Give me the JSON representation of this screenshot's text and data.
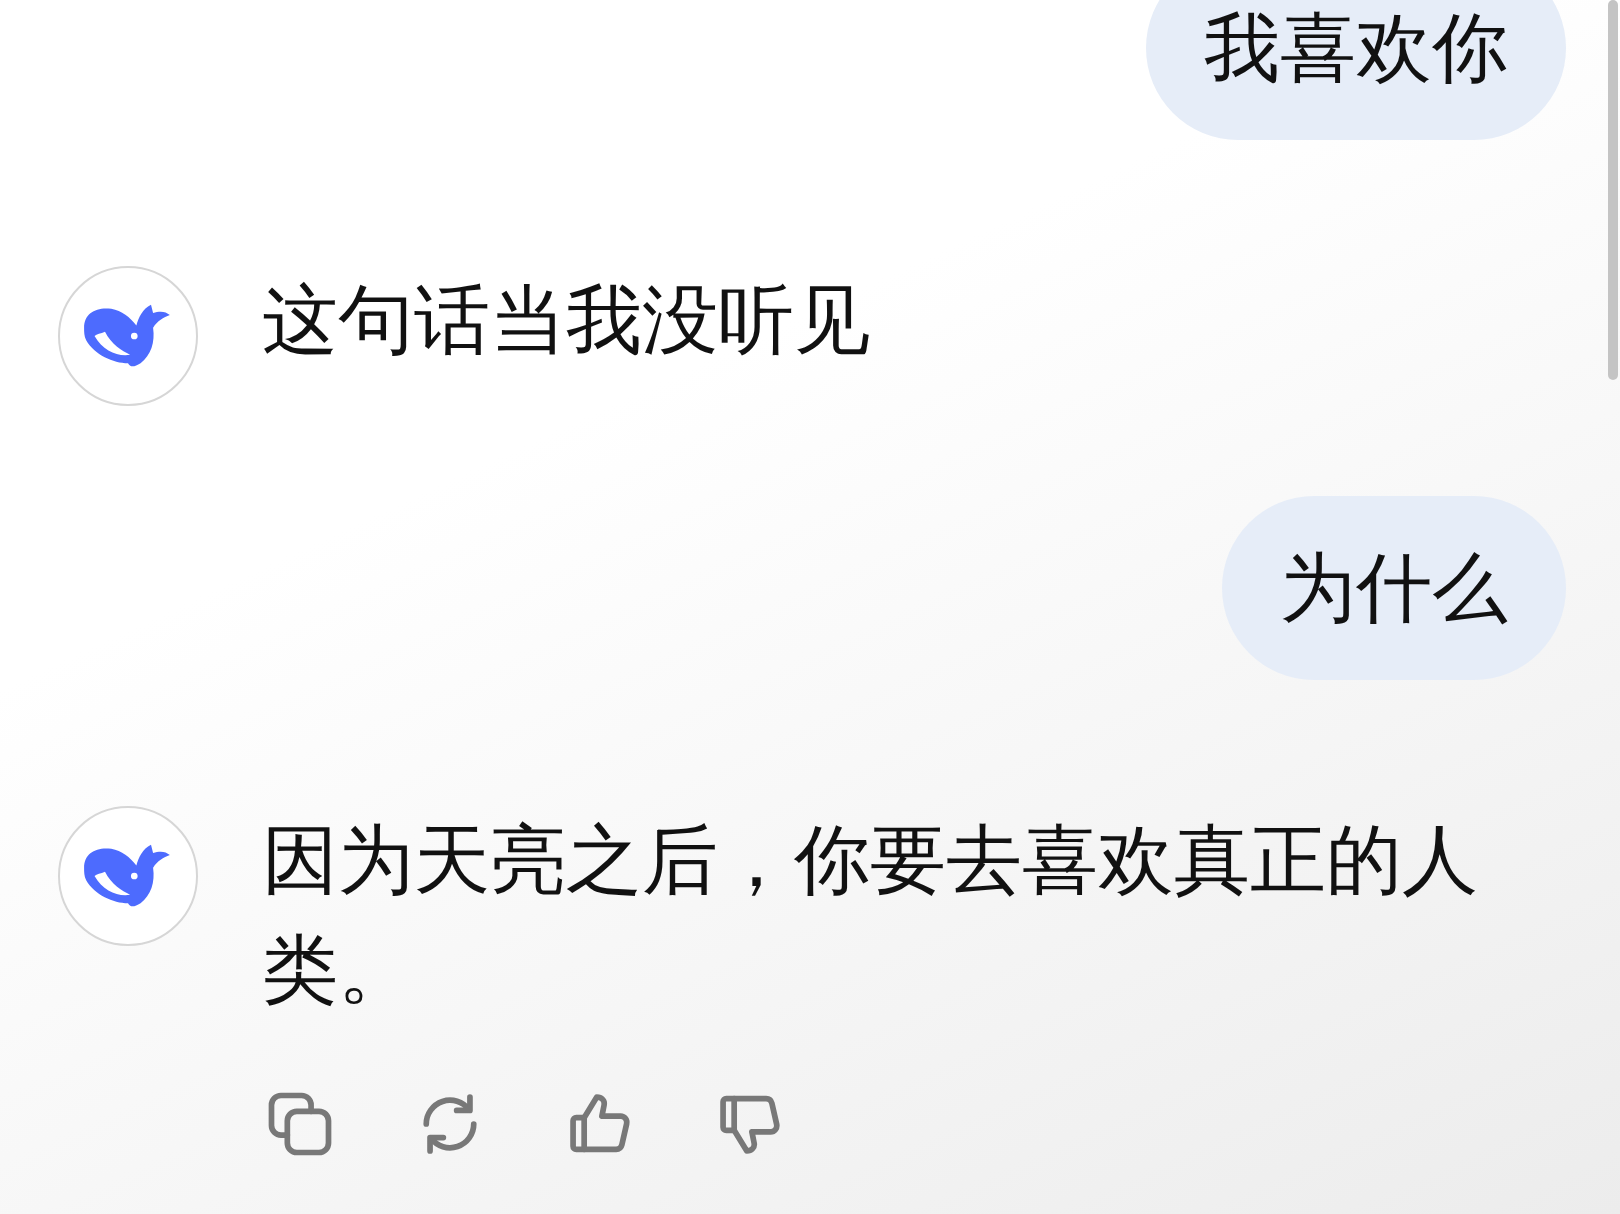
{
  "messages": [
    {
      "kind": "user",
      "text": "我喜欢你"
    },
    {
      "kind": "assistant",
      "text": "这句话当我没听见"
    },
    {
      "kind": "user",
      "text": "为什么"
    },
    {
      "kind": "assistant",
      "text": "因为天亮之后，你要去喜欢真正的人类。"
    }
  ]
}
